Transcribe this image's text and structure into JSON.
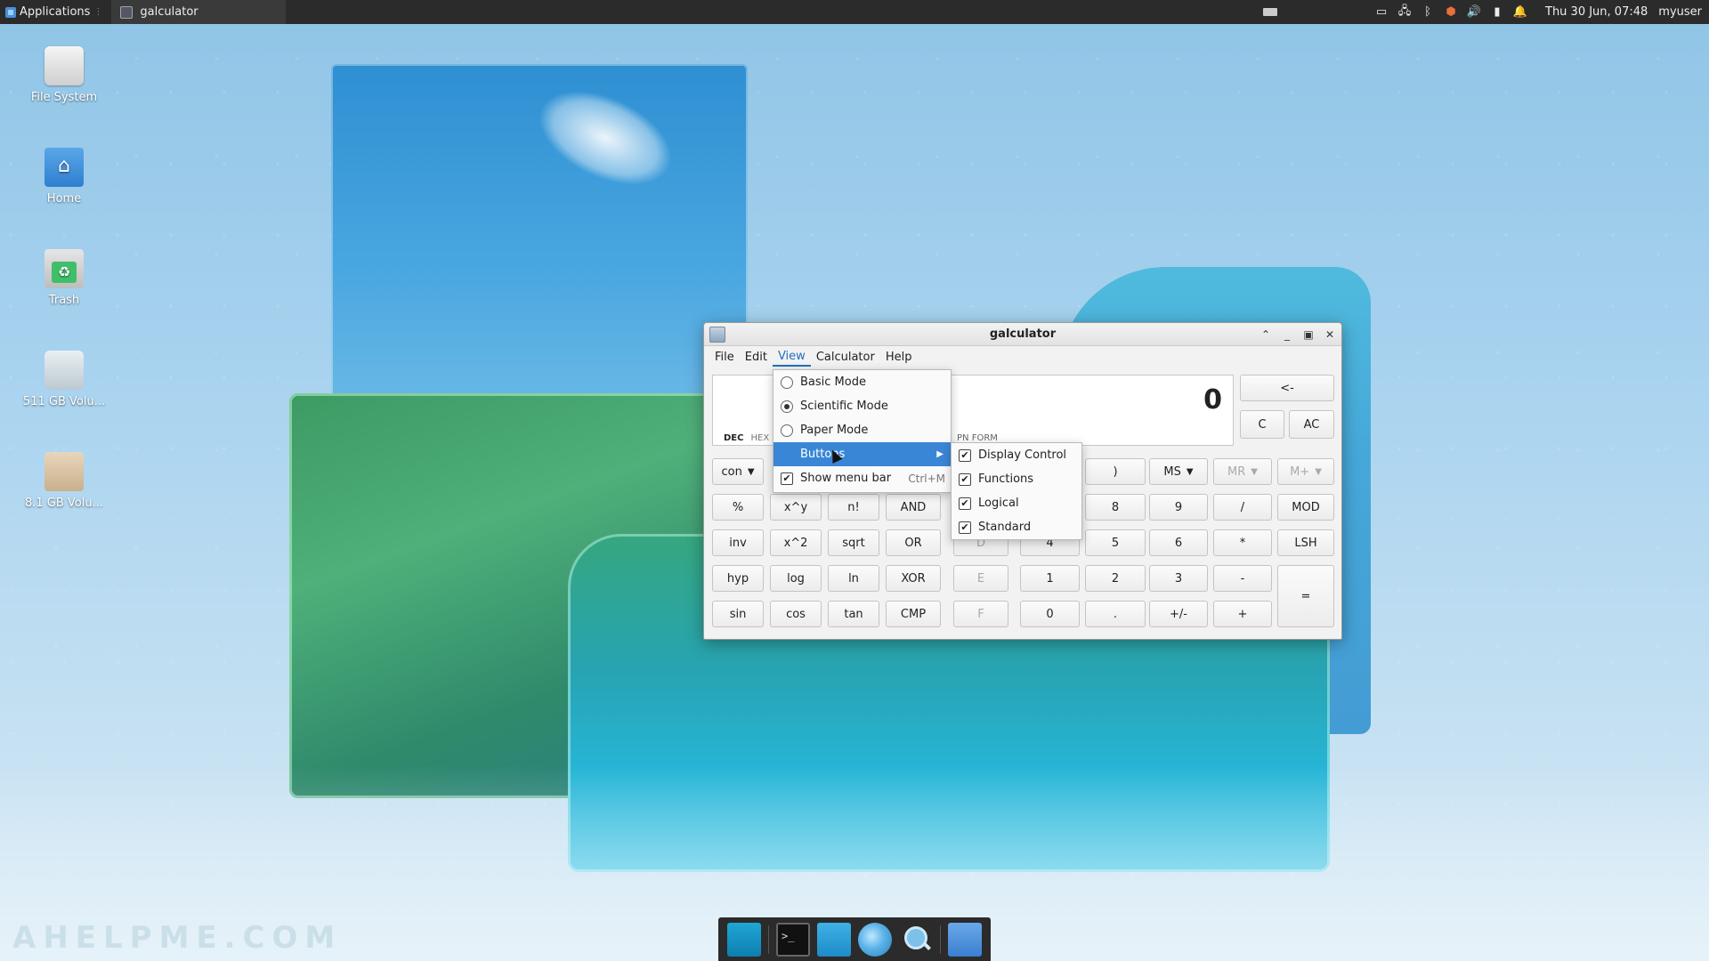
{
  "top_panel": {
    "applications_label": "Applications",
    "task_title": "galculator",
    "clock": "Thu 30 Jun, 07:48",
    "user": "myuser",
    "tray_icons": [
      "storage-icon",
      "network-icon",
      "bluetooth-icon",
      "shield-icon",
      "volume-icon",
      "power-icon",
      "bell-icon"
    ]
  },
  "desktop": {
    "icons": [
      {
        "name": "file-system",
        "label": "File System"
      },
      {
        "name": "home",
        "label": "Home"
      },
      {
        "name": "trash",
        "label": "Trash"
      },
      {
        "name": "volume-511",
        "label": "511 GB Volu..."
      },
      {
        "name": "volume-8",
        "label": "8.1 GB Volu..."
      }
    ]
  },
  "window": {
    "title": "galculator",
    "menu": [
      "File",
      "Edit",
      "View",
      "Calculator",
      "Help"
    ],
    "display": {
      "value": "0",
      "modes": [
        "DEC",
        "HEX"
      ],
      "form": "PN  FORM"
    },
    "top_buttons": [
      "<-",
      "C",
      "AC"
    ],
    "row0": [
      "con",
      ")",
      "MS",
      "MR",
      "M+"
    ],
    "rows": [
      [
        "%",
        "x^y",
        "n!",
        "AND",
        "",
        "",
        "8",
        "9",
        "/",
        "MOD"
      ],
      [
        "inv",
        "x^2",
        "sqrt",
        "OR",
        "D",
        "4",
        "5",
        "6",
        "*",
        "LSH"
      ],
      [
        "hyp",
        "log",
        "ln",
        "XOR",
        "E",
        "1",
        "2",
        "3",
        "-",
        "="
      ],
      [
        "sin",
        "cos",
        "tan",
        "CMP",
        "F",
        "0",
        ".",
        "+/-",
        "+"
      ]
    ]
  },
  "view_menu": {
    "items": [
      {
        "label": "Basic Mode",
        "kind": "radio",
        "checked": false
      },
      {
        "label": "Scientific Mode",
        "kind": "radio",
        "checked": true
      },
      {
        "label": "Paper Mode",
        "kind": "radio",
        "checked": false
      },
      {
        "label": "Buttons",
        "kind": "submenu"
      },
      {
        "label": "Show menu bar",
        "kind": "check",
        "checked": true,
        "accel": "Ctrl+M"
      }
    ]
  },
  "buttons_submenu": {
    "items": [
      "Display Control",
      "Functions",
      "Logical",
      "Standard"
    ]
  },
  "dock": {
    "items": [
      "show-desktop-icon",
      "terminal-icon",
      "file-manager-icon",
      "web-browser-icon",
      "app-finder-icon",
      "folder-icon"
    ]
  },
  "watermark": "AHELPME.COM"
}
